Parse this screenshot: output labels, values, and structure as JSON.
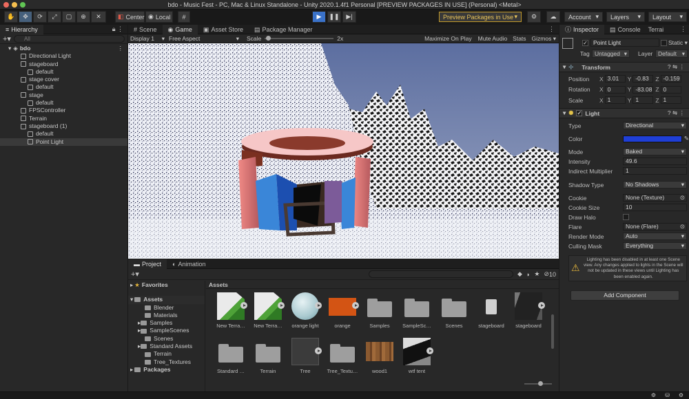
{
  "window": {
    "title": "bdo - Music Fest - PC, Mac & Linux Standalone - Unity 2020.1.4f1 Personal [PREVIEW PACKAGES IN USE] (Personal) <Metal>"
  },
  "toolbar": {
    "center": "Center",
    "local": "Local",
    "preview_packages": "Preview Packages in Use",
    "account": "Account",
    "layers": "Layers",
    "layout": "Layout"
  },
  "hierarchy": {
    "tab": "Hierarchy",
    "search_placeholder": "All",
    "root": "bdo",
    "items": [
      {
        "label": "Directional Light",
        "depth": 1
      },
      {
        "label": "stageboard",
        "depth": 1
      },
      {
        "label": "default",
        "depth": 2
      },
      {
        "label": "stage cover",
        "depth": 1
      },
      {
        "label": "default",
        "depth": 2
      },
      {
        "label": "stage",
        "depth": 1
      },
      {
        "label": "default",
        "depth": 2
      },
      {
        "label": "FPSController",
        "depth": 1
      },
      {
        "label": "Terrain",
        "depth": 1
      },
      {
        "label": "stageboard (1)",
        "depth": 1
      },
      {
        "label": "default",
        "depth": 2
      },
      {
        "label": "Point Light",
        "depth": 2
      }
    ]
  },
  "center_tabs": {
    "scene": "Scene",
    "game": "Game",
    "asset_store": "Asset Store",
    "package_manager": "Package Manager"
  },
  "game_bar": {
    "display": "Display 1",
    "aspect": "Free Aspect",
    "scale_label": "Scale",
    "scale_value": "2x",
    "maximize": "Maximize On Play",
    "mute": "Mute Audio",
    "stats": "Stats",
    "gizmos": "Gizmos"
  },
  "project": {
    "tab_project": "Project",
    "tab_animation": "Animation",
    "count": "10",
    "favorites": "Favorites",
    "assets": "Assets",
    "packages": "Packages",
    "tree": [
      "Blender",
      "Materials",
      "Samples",
      "SampleScenes",
      "Scenes",
      "Standard Assets",
      "Terrain",
      "Tree_Textures"
    ],
    "breadcrumb": "Assets",
    "grid": [
      {
        "name": "New Terra…",
        "kind": "terrain"
      },
      {
        "name": "New Terra…",
        "kind": "terrain"
      },
      {
        "name": "orange light",
        "kind": "sphere"
      },
      {
        "name": "orange",
        "kind": "orange"
      },
      {
        "name": "Samples",
        "kind": "folder"
      },
      {
        "name": "SampleSc…",
        "kind": "folder"
      },
      {
        "name": "Scenes",
        "kind": "folder"
      },
      {
        "name": "stageboard",
        "kind": "doc"
      },
      {
        "name": "stageboard",
        "kind": "board"
      },
      {
        "name": "Standard …",
        "kind": "folder"
      },
      {
        "name": "Terrain",
        "kind": "folder"
      },
      {
        "name": "Tree",
        "kind": "tree"
      },
      {
        "name": "Tree_Textu…",
        "kind": "folder"
      },
      {
        "name": "wood1",
        "kind": "wood"
      },
      {
        "name": "wtf tent",
        "kind": "tent"
      }
    ]
  },
  "inspector": {
    "tab": "Inspector",
    "tab_console": "Console",
    "tab_terrain": "Terrai",
    "object_name": "Point Light",
    "static": "Static",
    "tag_label": "Tag",
    "tag": "Untagged",
    "layer_label": "Layer",
    "layer": "Default",
    "transform": {
      "title": "Transform",
      "position": {
        "label": "Position",
        "x": "3.01",
        "y": "-0.83",
        "z": "-0.159"
      },
      "rotation": {
        "label": "Rotation",
        "x": "0",
        "y": "-83.08",
        "z": "0"
      },
      "scale": {
        "label": "Scale",
        "x": "1",
        "y": "1",
        "z": "1"
      }
    },
    "light": {
      "title": "Light",
      "type_label": "Type",
      "type": "Directional",
      "color_label": "Color",
      "color_value": "#1f3fd6",
      "mode_label": "Mode",
      "mode": "Baked",
      "intensity_label": "Intensity",
      "intensity": "49.6",
      "indirect_label": "Indirect Multiplier",
      "indirect": "1",
      "shadow_label": "Shadow Type",
      "shadow": "No Shadows",
      "cookie_label": "Cookie",
      "cookie": "None (Texture)",
      "cookie_size_label": "Cookie Size",
      "cookie_size": "10",
      "draw_halo_label": "Draw Halo",
      "flare_label": "Flare",
      "flare": "None (Flare)",
      "render_mode_label": "Render Mode",
      "render_mode": "Auto",
      "culling_label": "Culling Mask",
      "culling": "Everything"
    },
    "warning": "Lighting has been disabled in at least one Scene view. Any changes applied to lights in the Scene will not be updated in these views until Lighting has been enabled again.",
    "add_component": "Add Component"
  },
  "colors": {
    "accent": "#46607c",
    "preview_border": "#c29a2a",
    "light_color": "#1f3fd6"
  }
}
